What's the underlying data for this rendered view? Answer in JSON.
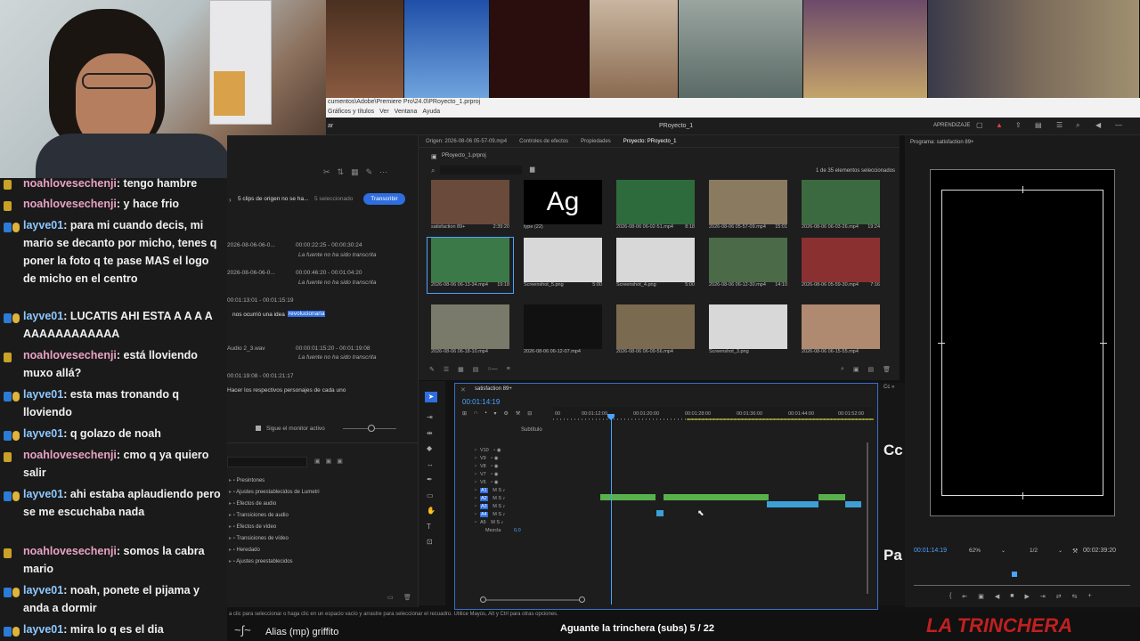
{
  "menubar": {
    "path": "cumentos\\Adobe\\Premiere Pro\\24.0\\PRoyecto_1.prproj",
    "menus": [
      "Gráficos y títulos",
      "Ver",
      "Ventana",
      "Ayuda"
    ],
    "left_label": "ar"
  },
  "header": {
    "project_title": "PRoyecto_1",
    "learn": "APRENDIZAJE"
  },
  "chat": {
    "messages": [
      {
        "user": "noahlovesechenji",
        "text": ": tengo hambre",
        "color": "pink"
      },
      {
        "user": "noahlovesechenji",
        "text": ": y hace frio",
        "color": "pink"
      },
      {
        "user": "layve01",
        "text": ": para mi cuando decis, mi      mario se decanto por micho, tenes q poner la foto q te pase MAS el logo de micho en el centro",
        "color": "blue"
      },
      {
        "user": "layve01",
        "text": ": LUCATIS AHI ESTA A A A A AAAAAAAAAAAA",
        "color": "blue"
      },
      {
        "user": "noahlovesechenji",
        "text": ": está lloviendo muxo allá?",
        "color": "pink"
      },
      {
        "user": "layve01",
        "text": ": esta mas tronando q lloviendo",
        "color": "blue"
      },
      {
        "user": "layve01",
        "text": ": q golazo de noah",
        "color": "blue"
      },
      {
        "user": "noahlovesechenji",
        "text": ": cmo q ya quiero salir",
        "color": "pink"
      },
      {
        "user": "layve01",
        "text": ": ahi estaba aplaudiendo pero se me escuchaba nada",
        "color": "blue"
      },
      {
        "user": "noahlovesechenji",
        "text": ": somos la cabra mario",
        "color": "pink"
      },
      {
        "user": "layve01",
        "text": ": noah, ponete el pijama y anda a dormir",
        "color": "blue"
      },
      {
        "user": "layve01",
        "text": ": mira lo q es el dia",
        "color": "blue"
      }
    ]
  },
  "leftpanel": {
    "header": "5 clips de origen no se ha...",
    "selected": "5 seleccionado",
    "transcribe": "Transcribir",
    "rows": [
      {
        "name": "2026-08-06-06-0...",
        "time": "00:00:22:25 - 00:00:30:24",
        "note": "La fuente no ha sido transcrita"
      },
      {
        "name": "2026-08-06-06-0...",
        "time": "00:00:46:20 - 00:01:04:20",
        "note": "La fuente no ha sido transcrita"
      },
      {
        "name": "00:01:13:01 - 00:01:15:19",
        "time": "",
        "note": ""
      },
      {
        "name": "Audio 2_3.wav",
        "time": "00:00:01:15:20 - 00:01:19:08",
        "note": "La fuente no ha sido transcrita"
      },
      {
        "name": "00:01:19:08 - 00:01:21:17",
        "time": "",
        "note": ""
      }
    ],
    "idea_text": "nos ocurrió una idea",
    "idea_highlight": "revolucionaria",
    "caption": "Hacer los respectivos personajes de cada uno",
    "monitor": "Sigue el monitor activo",
    "effects": [
      "Presintones",
      "Ajustes preestablecidos de Lumetri",
      "Efectos de audio",
      "Transiciones de audio",
      "Efectos de vídeo",
      "Transiciones de vídeo",
      "Heredado",
      "Ajustes preestablecidos"
    ]
  },
  "project": {
    "tabs": [
      "Origen: 2026-08-06 05-57-09.mp4",
      "Controles de efectos",
      "Propiedades",
      "Proyecto: PRoyecto_1"
    ],
    "file": "PRoyecto_1.prproj",
    "count": "1 de 35 elementos seleccionados",
    "tiles": [
      {
        "name": "satisfaction 89+",
        "dur": "2:39:20",
        "color": "#6a4a3a"
      },
      {
        "name": "type (22)",
        "dur": "",
        "color": "#000000"
      },
      {
        "name": "2026-08-06 06-02-51.mp4",
        "dur": "8:18",
        "color": "#2e6b3c"
      },
      {
        "name": "2026-08-06 05-57-09.mp4",
        "dur": "15:01",
        "color": "#8a7a60"
      },
      {
        "name": "2026-08-06 06-03-26.mp4",
        "dur": "19:24",
        "color": "#3c6a40"
      },
      {
        "name": "2026-08-06 06-13-34.mp4",
        "dur": "19:18",
        "color": "#3b7a48"
      },
      {
        "name": "Screenshot_5.png",
        "dur": "5:00",
        "color": "#d8d8d8"
      },
      {
        "name": "Screenshot_4.png",
        "dur": "5:00",
        "color": "#d8d8d8"
      },
      {
        "name": "2026-08-06 06-12-30.mp4",
        "dur": "14:10",
        "color": "#4a6a48"
      },
      {
        "name": "2026-08-06 05-59-30.mp4",
        "dur": "7:16",
        "color": "#8a3030"
      },
      {
        "name": "2026-08-06 06-18-10.mp4",
        "dur": "",
        "color": "#7a7a6a"
      },
      {
        "name": "2026-08-06 06-12-07.mp4",
        "dur": "",
        "color": "#111111"
      },
      {
        "name": "2026-08-06 06-09-56.mp4",
        "dur": "",
        "color": "#7a6a50"
      },
      {
        "name": "Screenshot_3.png",
        "dur": "",
        "color": "#d8d8d8"
      },
      {
        "name": "2026-08-06 06-15-55.mp4",
        "dur": "",
        "color": "#b08a70"
      }
    ]
  },
  "timeline": {
    "tab": "satisfaction 89+",
    "timecode": "00:01:14:19",
    "ruler": [
      "00",
      "00:01:12:00",
      "00:01:20:00",
      "00:01:28:00",
      "00:01:36:00",
      "00:01:44:00",
      "00:01:52:00"
    ],
    "subtitle_track": "Subtítulo",
    "tracks": [
      "V10",
      "V9",
      "V8",
      "V7",
      "V6",
      "A1",
      "A2",
      "A3",
      "A4",
      "A5"
    ],
    "mix": "Mezcla",
    "mix_value": "0,0"
  },
  "program": {
    "title": "Programa: satisfaction 89+",
    "timecode": "00:01:14:19",
    "zoom": "62%",
    "quality": "1/2",
    "duration": "00:02:39:20"
  },
  "side": {
    "cc": "Cc",
    "pa": "Pa"
  },
  "status": {
    "hint": "a clic para seleccionar o haga clic en un espacio vacío y arrastre para seleccionar el recuadro. Utilice Mayús, Alt y Ctrl para otras opciones.",
    "alias": "Alias (mp) griffito",
    "song": "Aguante la trinchera (subs) 5 / 22",
    "brand": "LA TRINCHERA"
  }
}
